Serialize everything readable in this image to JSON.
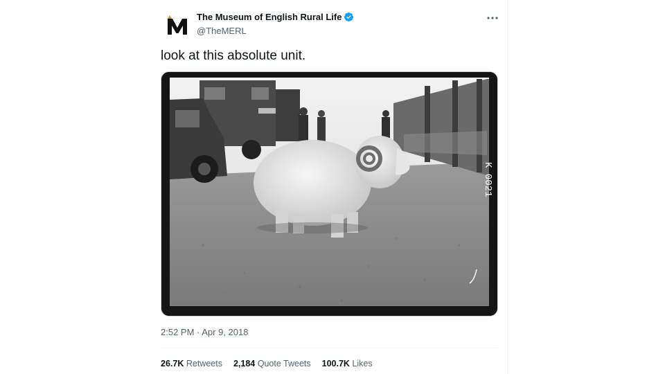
{
  "tweet": {
    "author_name": "The Museum of English Rural Life",
    "author_handle": "@TheMERL",
    "verified": true,
    "avatar_letter": "M",
    "text": "look at this absolute unit.",
    "photo_margin_text": "K 0021",
    "timestamp": "2:52 PM · Apr 9, 2018",
    "stats": [
      {
        "value": "26.7K",
        "label": "Retweets"
      },
      {
        "value": "2,184",
        "label": "Quote Tweets"
      },
      {
        "value": "100.7K",
        "label": "Likes"
      }
    ]
  },
  "colors": {
    "verified_badge": "#1d9bf0",
    "secondary_text": "#536471",
    "primary_text": "#0f1419",
    "avatar_accent": "#c99a2e"
  },
  "icons": [
    "more-icon",
    "verified-badge-icon"
  ]
}
